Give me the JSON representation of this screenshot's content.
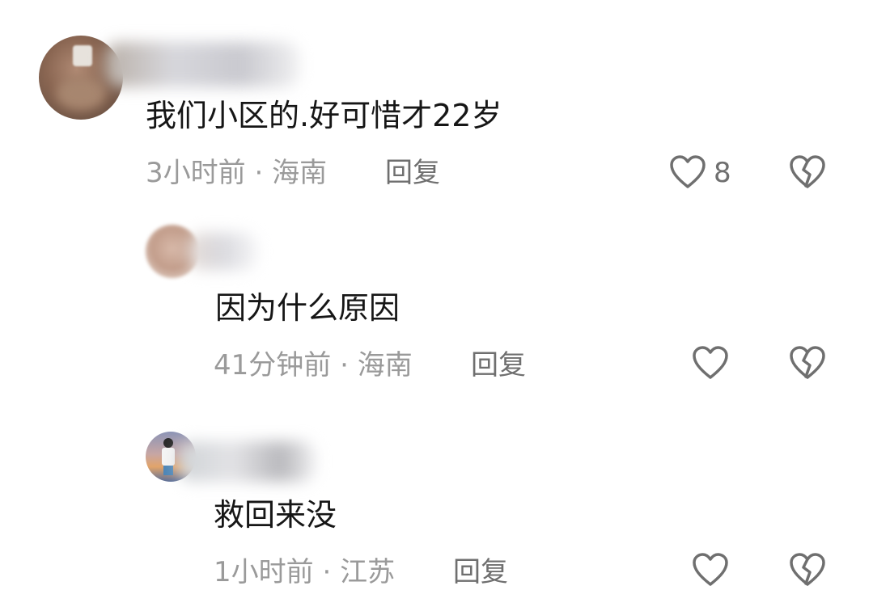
{
  "comments": [
    {
      "text": "我们小区的.好可惜才22岁",
      "time": "3小时前",
      "location": "海南",
      "reply_label": "回复",
      "like_count": "8",
      "like_icon": "heart-outline-icon",
      "dislike_icon": "broken-heart-icon"
    },
    {
      "text": "因为什么原因",
      "time": "41分钟前",
      "location": "海南",
      "reply_label": "回复",
      "like_count": "",
      "like_icon": "heart-outline-icon",
      "dislike_icon": "broken-heart-icon"
    },
    {
      "text": "救回来没",
      "time": "1小时前",
      "location": "江苏",
      "reply_label": "回复",
      "like_count": "",
      "like_icon": "heart-outline-icon",
      "dislike_icon": "broken-heart-icon"
    }
  ],
  "separator": " · ",
  "colors": {
    "text": "#161616",
    "meta": "#9a9a9a",
    "icon": "#6f6f6f",
    "background": "#ffffff"
  }
}
